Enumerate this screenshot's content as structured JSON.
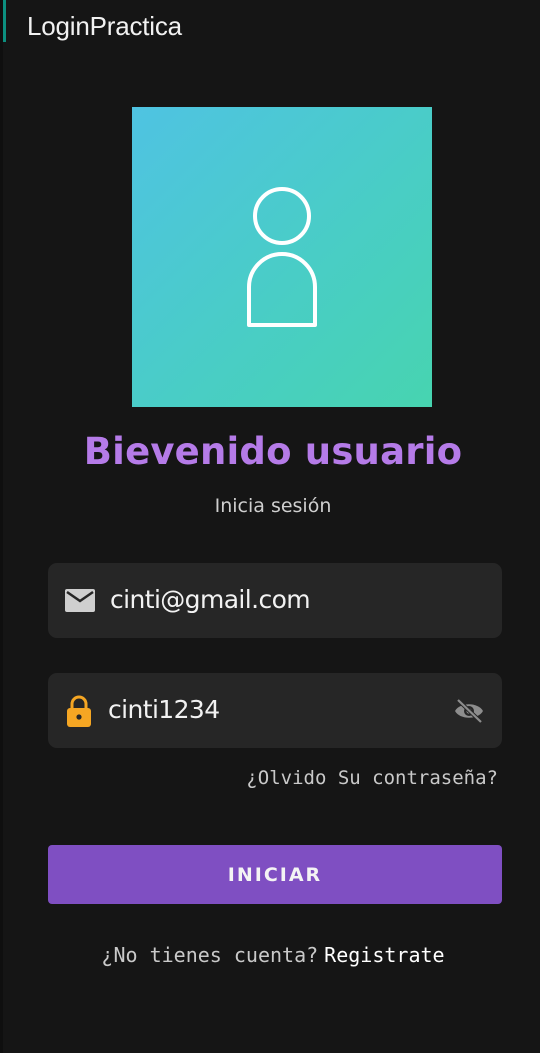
{
  "app": {
    "title": "LoginPractica"
  },
  "header": {
    "welcome": "Bievenido usuario",
    "subtitle": "Inicia sesión"
  },
  "email_field": {
    "value": "cinti@gmail.com",
    "icon": "mail-icon"
  },
  "password_field": {
    "value": "cinti1234",
    "icon": "lock-icon",
    "toggle_icon": "eye-off-icon"
  },
  "forgot_password": {
    "label": "¿Olvido Su contraseña?"
  },
  "login_button": {
    "label": "INICIAR"
  },
  "register": {
    "question": "¿No tienes cuenta?",
    "link": "Registrate"
  },
  "colors": {
    "background": "#151515",
    "accent_purple": "#7f4fc2",
    "welcome_text": "#b57be8",
    "field_bg": "#262626",
    "lock_icon": "#f5a623",
    "avatar_gradient": [
      "#4fc3e2",
      "#47d4b0"
    ]
  }
}
